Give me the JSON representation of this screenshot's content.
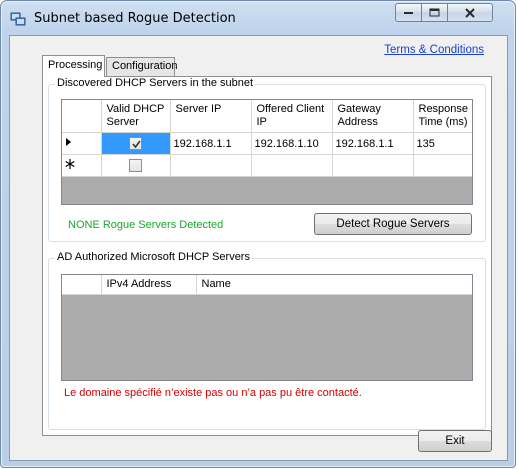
{
  "window": {
    "title": "Subnet based Rogue Detection",
    "icon": "network-connection-icon"
  },
  "header": {
    "terms_link": "Terms & Conditions"
  },
  "tabs": [
    {
      "label": "Processing",
      "active": true
    },
    {
      "label": "Configuration",
      "active": false
    }
  ],
  "discovered": {
    "group_title": "Discovered DHCP Servers in the subnet",
    "columns": [
      "Valid DHCP Server",
      "Server IP",
      "Offered Client IP",
      "Gateway Address",
      "Response Time (ms)"
    ],
    "rows": [
      {
        "indicator": "current-row-arrow",
        "valid": true,
        "server_ip": "192.168.1.1",
        "offered_ip": "192.168.1.10",
        "gateway": "192.168.1.1",
        "response_time": "135"
      },
      {
        "indicator": "new-row-asterisk",
        "valid": false,
        "server_ip": "",
        "offered_ip": "",
        "gateway": "",
        "response_time": ""
      }
    ],
    "status": "NONE Rogue Servers Detected",
    "detect_button": "Detect Rogue Servers"
  },
  "authorized": {
    "group_title": "AD Authorized Microsoft DHCP Servers",
    "columns": [
      "IPv4 Address",
      "Name"
    ],
    "error": "Le domaine spécifié n’existe pas ou n’a pas pu être contacté."
  },
  "footer": {
    "exit_button": "Exit"
  },
  "colors": {
    "status_green": "#18a82a",
    "error_red": "#d60000",
    "link_blue": "#1a3fd1",
    "selection_blue": "#3399ff"
  }
}
